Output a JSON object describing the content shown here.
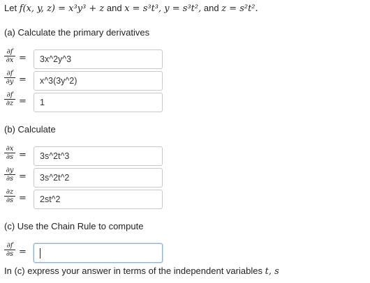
{
  "intro": {
    "let": "Let",
    "f_def": "f(x, y, z) = x³y³ + z",
    "and1": "and",
    "x_def": "x = s³t³, y = s³t²,",
    "and2": "and",
    "z_def": "z = s²t²."
  },
  "part_a": {
    "heading": "(a) Calculate the primary derivatives",
    "rows": [
      {
        "num": "∂f",
        "den": "∂x",
        "value": "3x^2y^3"
      },
      {
        "num": "∂f",
        "den": "∂y",
        "value": "x^3(3y^2)"
      },
      {
        "num": "∂f",
        "den": "∂z",
        "value": "1"
      }
    ]
  },
  "part_b": {
    "heading": "(b) Calculate",
    "rows": [
      {
        "num": "∂x",
        "den": "∂s",
        "value": "3s^2t^3"
      },
      {
        "num": "∂y",
        "den": "∂s",
        "value": "3s^2t^2"
      },
      {
        "num": "∂z",
        "den": "∂s",
        "value": "2st^2"
      }
    ]
  },
  "part_c": {
    "heading": "(c) Use the Chain Rule to compute",
    "row": {
      "num": "∂f",
      "den": "∂s",
      "value": ""
    },
    "note_prefix": "In (c) express your answer in terms of the independent variables",
    "note_vars": "t, s"
  },
  "equals": "="
}
